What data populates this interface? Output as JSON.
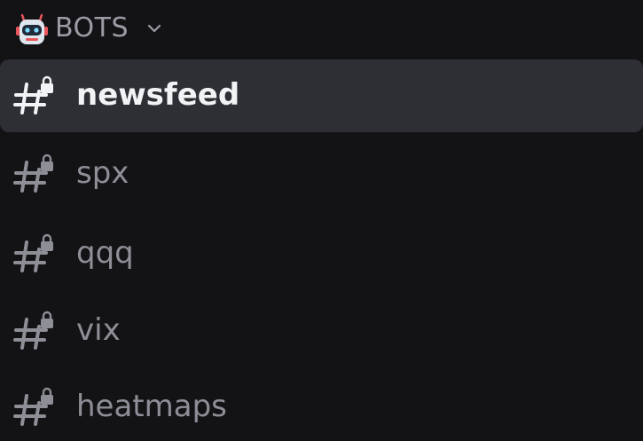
{
  "category": {
    "name": "BOTS",
    "icon": "robot-icon",
    "expanded_icon": "chevron-down-icon"
  },
  "channels": [
    {
      "label": "newsfeed",
      "icon": "locked-hash-icon",
      "selected": true
    },
    {
      "label": "spx",
      "icon": "locked-hash-icon",
      "selected": false
    },
    {
      "label": "qqq",
      "icon": "locked-hash-icon",
      "selected": false
    },
    {
      "label": "vix",
      "icon": "locked-hash-icon",
      "selected": false
    },
    {
      "label": "heatmaps",
      "icon": "locked-hash-icon",
      "selected": false
    }
  ],
  "colors": {
    "background": "#131316",
    "selected_row": "#2e2f35",
    "text_active": "#f2f3f5",
    "text_muted": "#8d8e96",
    "robot_accent": "#e8555a",
    "robot_face": "#cfd8e3"
  }
}
